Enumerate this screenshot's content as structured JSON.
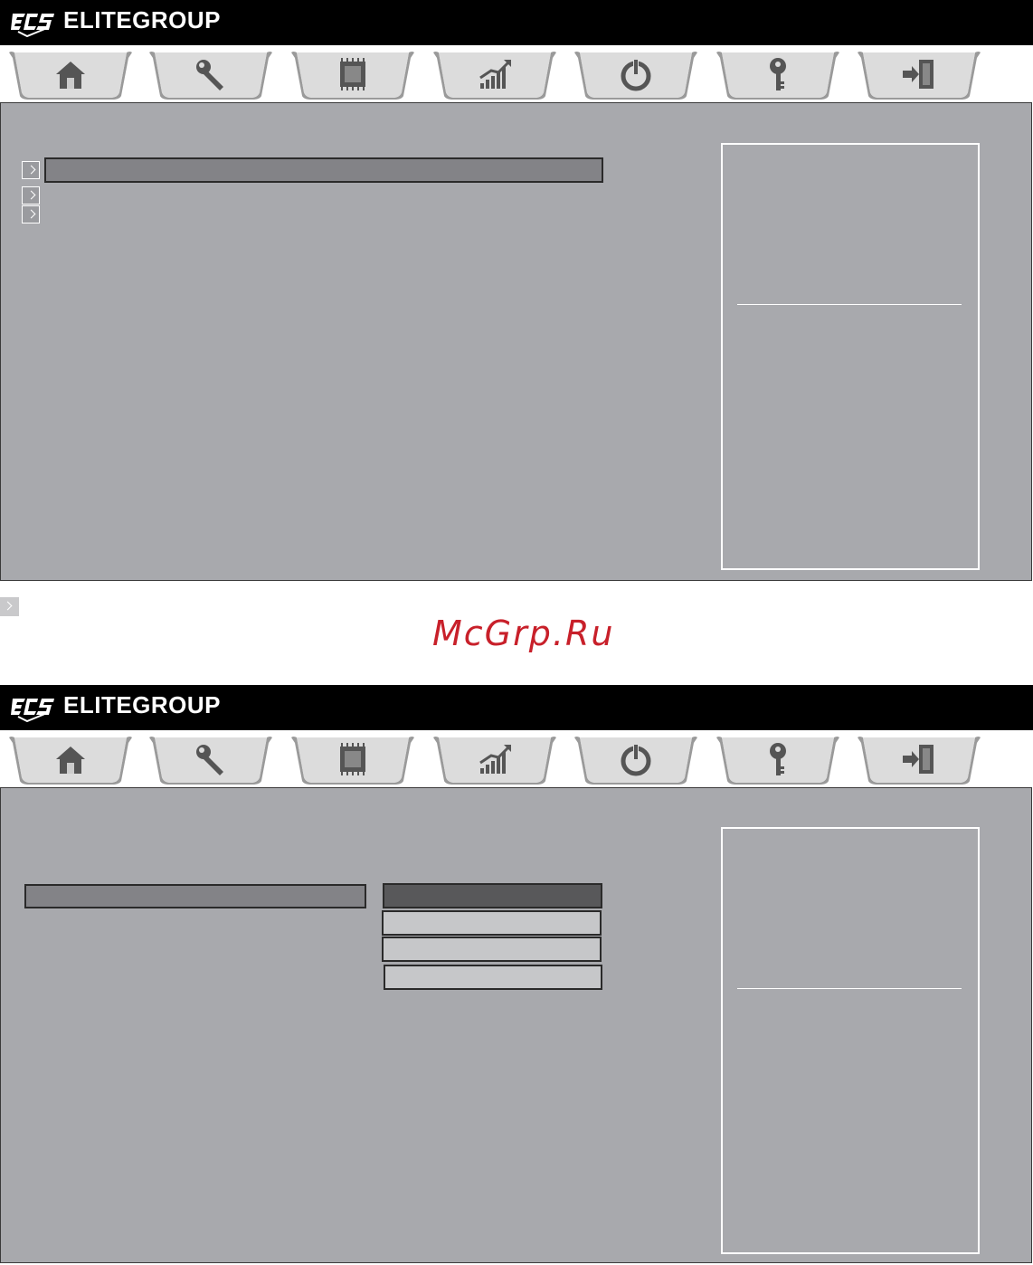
{
  "brand": "ELITEGROUP",
  "logo": "ECS",
  "watermark": "McGrp.Ru",
  "tabs": [
    {
      "name": "main",
      "icon": "home-icon"
    },
    {
      "name": "advanced",
      "icon": "wrench-icon"
    },
    {
      "name": "chipset",
      "icon": "chip-icon"
    },
    {
      "name": "mib",
      "icon": "chart-icon"
    },
    {
      "name": "boot",
      "icon": "power-icon"
    },
    {
      "name": "security",
      "icon": "key-icon"
    },
    {
      "name": "exit",
      "icon": "exit-icon"
    }
  ],
  "colors": {
    "panel": "#a8a9ad",
    "highlight": "#838387",
    "selected_option": "#58585a",
    "option": "#c6c7c9",
    "watermark": "#c8202a"
  }
}
